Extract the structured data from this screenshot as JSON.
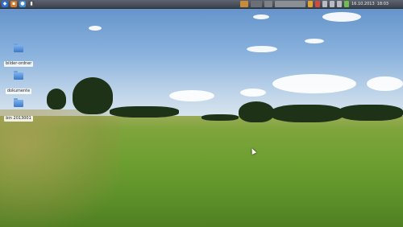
{
  "panel": {
    "launchers": [
      {
        "name": "start-menu",
        "glyph": "◆",
        "color": "#2d6ed8"
      },
      {
        "name": "file-manager",
        "glyph": "▪",
        "color": "#d77b2a"
      },
      {
        "name": "web-browser",
        "glyph": "●",
        "color": "#3f8fd8"
      },
      {
        "name": "terminal",
        "glyph": "▮",
        "color": "#4a4f57"
      }
    ],
    "tray_date": "16.10.2013",
    "clock": "18:03"
  },
  "desktop": {
    "icons": [
      {
        "label": "bilder-ordner",
        "icon": "folder-icon"
      },
      {
        "label": "dokumente",
        "icon": "folder-icon"
      },
      {
        "label": "bin 2013001",
        "icon": "folder-icon"
      }
    ]
  },
  "colors": {
    "panel": "#3b414b",
    "sky": "#8ab2dd",
    "grass": "#6e9f31"
  }
}
